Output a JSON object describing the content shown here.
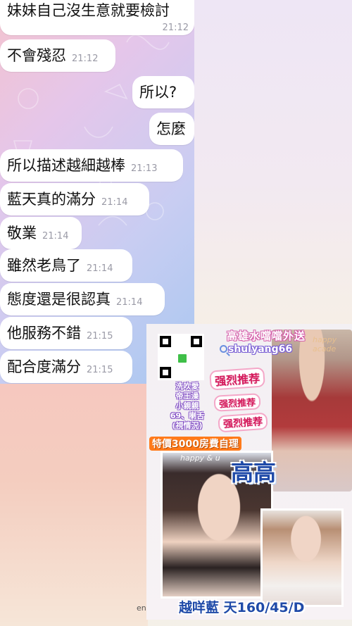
{
  "chat": {
    "messages": [
      {
        "text": "妹妹自己沒生意就要檢討",
        "time": "21:12",
        "side": "in"
      },
      {
        "text": "不會殘忍",
        "time": "21:12",
        "side": "in"
      },
      {
        "text": "所以?",
        "time": "",
        "side": "out"
      },
      {
        "text": "怎麼",
        "time": "",
        "side": "out"
      },
      {
        "text": "所以描述越細越棒",
        "time": "21:13",
        "side": "in"
      },
      {
        "text": "藍天真的滿分",
        "time": "21:14",
        "side": "in"
      },
      {
        "text": "敬業",
        "time": "21:14",
        "side": "in"
      },
      {
        "text": "雖然老鳥了",
        "time": "21:14",
        "side": "in"
      },
      {
        "text": "態度還是很認真",
        "time": "21:14",
        "side": "in"
      },
      {
        "text": "他服務不錯",
        "time": "21:15",
        "side": "in"
      },
      {
        "text": "配合度滿分",
        "time": "21:15",
        "side": "in"
      }
    ]
  },
  "ad": {
    "title": "高雄水噹噹外送",
    "handle": "shulyang66",
    "services": [
      "洗吹愛",
      "帝王澡",
      "小親親",
      "69、喇舌",
      "(視情況)"
    ],
    "stamps": [
      "强烈推荐",
      "强烈推荐",
      "强烈推荐"
    ],
    "price": "特價3000房費自理",
    "name": "高高",
    "stats": "越咩藍 天160/45/D",
    "deco_top": "happy acade",
    "deco_mid": "happy & u"
  },
  "footer": {
    "label": "en"
  },
  "icons": {
    "qr": "qr-code-icon",
    "search": "search-icon"
  }
}
